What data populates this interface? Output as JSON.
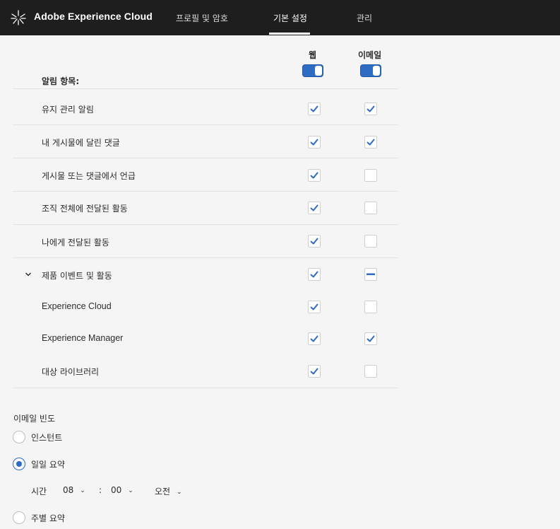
{
  "header": {
    "brand": "Adobe Experience Cloud",
    "logo_icon": "adobe-experience-cloud-logo-icon",
    "tabs": [
      {
        "label": "프로필 및 암호",
        "active": false
      },
      {
        "label": "기본 설정",
        "active": true
      },
      {
        "label": "관리",
        "active": false
      }
    ]
  },
  "notifications": {
    "section_label": "알림 항목:",
    "columns": {
      "web": "웹",
      "email": "이메일"
    },
    "toggles": {
      "web": true,
      "email": true
    },
    "rows": [
      {
        "label": "유지 관리 알림",
        "web": "checked",
        "email": "checked"
      },
      {
        "label": "내 게시물에 달린 댓글",
        "web": "checked",
        "email": "checked"
      },
      {
        "label": "게시물 또는 댓글에서 언급",
        "web": "checked",
        "email": "unchecked"
      },
      {
        "label": "조직 전체에 전달된 활동",
        "web": "checked",
        "email": "unchecked"
      },
      {
        "label": "나에게 전달된 활동",
        "web": "checked",
        "email": "unchecked"
      },
      {
        "label": "제품 이벤트 및 활동",
        "web": "checked",
        "email": "indeterminate",
        "expanded": true
      },
      {
        "label": "Experience Cloud",
        "web": "checked",
        "email": "unchecked"
      },
      {
        "label": "Experience Manager",
        "web": "checked",
        "email": "checked"
      },
      {
        "label": "대상 라이브러리",
        "web": "checked",
        "email": "unchecked"
      }
    ]
  },
  "email_frequency": {
    "title": "이메일 빈도",
    "options": [
      {
        "label": "인스턴트",
        "selected": false
      },
      {
        "label": "일일 요약",
        "selected": true
      },
      {
        "label": "주별 요약",
        "selected": false
      }
    ],
    "time": {
      "label": "시간",
      "hour": "08",
      "separator": ":",
      "minute": "00",
      "period": "오전"
    }
  },
  "colors": {
    "accent": "#2d6cc0",
    "topbar": "#1e1e1e",
    "background": "#f5f5f5"
  }
}
